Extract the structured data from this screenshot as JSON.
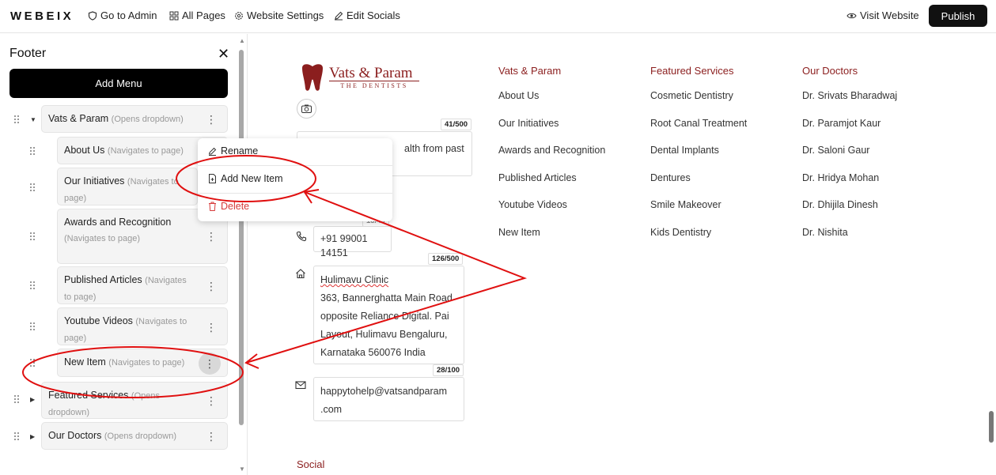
{
  "topbar": {
    "logo": "WEBEIX",
    "nav": [
      "Go to Admin",
      "All Pages",
      "Website Settings",
      "Edit Socials"
    ],
    "visit": "Visit Website",
    "publish": "Publish"
  },
  "sidebar": {
    "title": "Footer",
    "add_menu": "Add Menu",
    "items": [
      {
        "label": "Vats & Param",
        "hint": "(Opens dropdown)"
      },
      {
        "label": "About Us",
        "hint": "(Navigates to page)"
      },
      {
        "label": "Our Initiatives",
        "hint": "(Navigates to page)"
      },
      {
        "label": "Awards and Recognition",
        "hint": "(Navigates to page)"
      },
      {
        "label": "Published Articles",
        "hint": "(Navigates to page)"
      },
      {
        "label": "Youtube Videos",
        "hint": "(Navigates to page)"
      },
      {
        "label": "New Item",
        "hint": "(Navigates to page)"
      },
      {
        "label": "Featured Services",
        "hint": "(Opens dropdown)"
      },
      {
        "label": "Our Doctors",
        "hint": "(Opens dropdown)"
      }
    ]
  },
  "context_menu": {
    "rename": "Rename",
    "add_new": "Add New Item",
    "delete": "Delete"
  },
  "preview": {
    "brand_name": "Vats & Param",
    "brand_sub": "THE DENTISTS",
    "tagline_counter": "41/500",
    "tagline_text": "alth from past",
    "phone_counter": "13/40",
    "phone": "+91 99001 14151",
    "address_counter": "126/500",
    "address_lines": [
      "Hulimavu Clinic",
      "363, Bannerghatta Main Road",
      "opposite Reliance Digital. Pai",
      "Layout, Hulimavu Bengaluru,",
      "Karnataka 560076 India"
    ],
    "email_counter": "28/100",
    "email_lines": [
      "happytohelp@vatsandparam",
      ".com"
    ],
    "social": "Social",
    "columns": [
      {
        "head": "Vats & Param",
        "links": [
          "About Us",
          "Our Initiatives",
          "Awards and Recognition",
          "Published Articles",
          "Youtube Videos",
          "New Item"
        ]
      },
      {
        "head": "Featured Services",
        "links": [
          "Cosmetic Dentistry",
          "Root Canal Treatment",
          "Dental Implants",
          "Dentures",
          "Smile Makeover",
          "Kids Dentistry"
        ]
      },
      {
        "head": "Our Doctors",
        "links": [
          "Dr. Srivats Bharadwaj",
          "Dr. Paramjot Kaur",
          "Dr. Saloni Gaur",
          "Dr. Hridya Mohan",
          "Dr. Dhijila Dinesh",
          "Dr. Nishita"
        ]
      }
    ]
  },
  "colors": {
    "accent": "#8b1e1e",
    "annotation": "#e01010",
    "primary_button": "#000000"
  }
}
